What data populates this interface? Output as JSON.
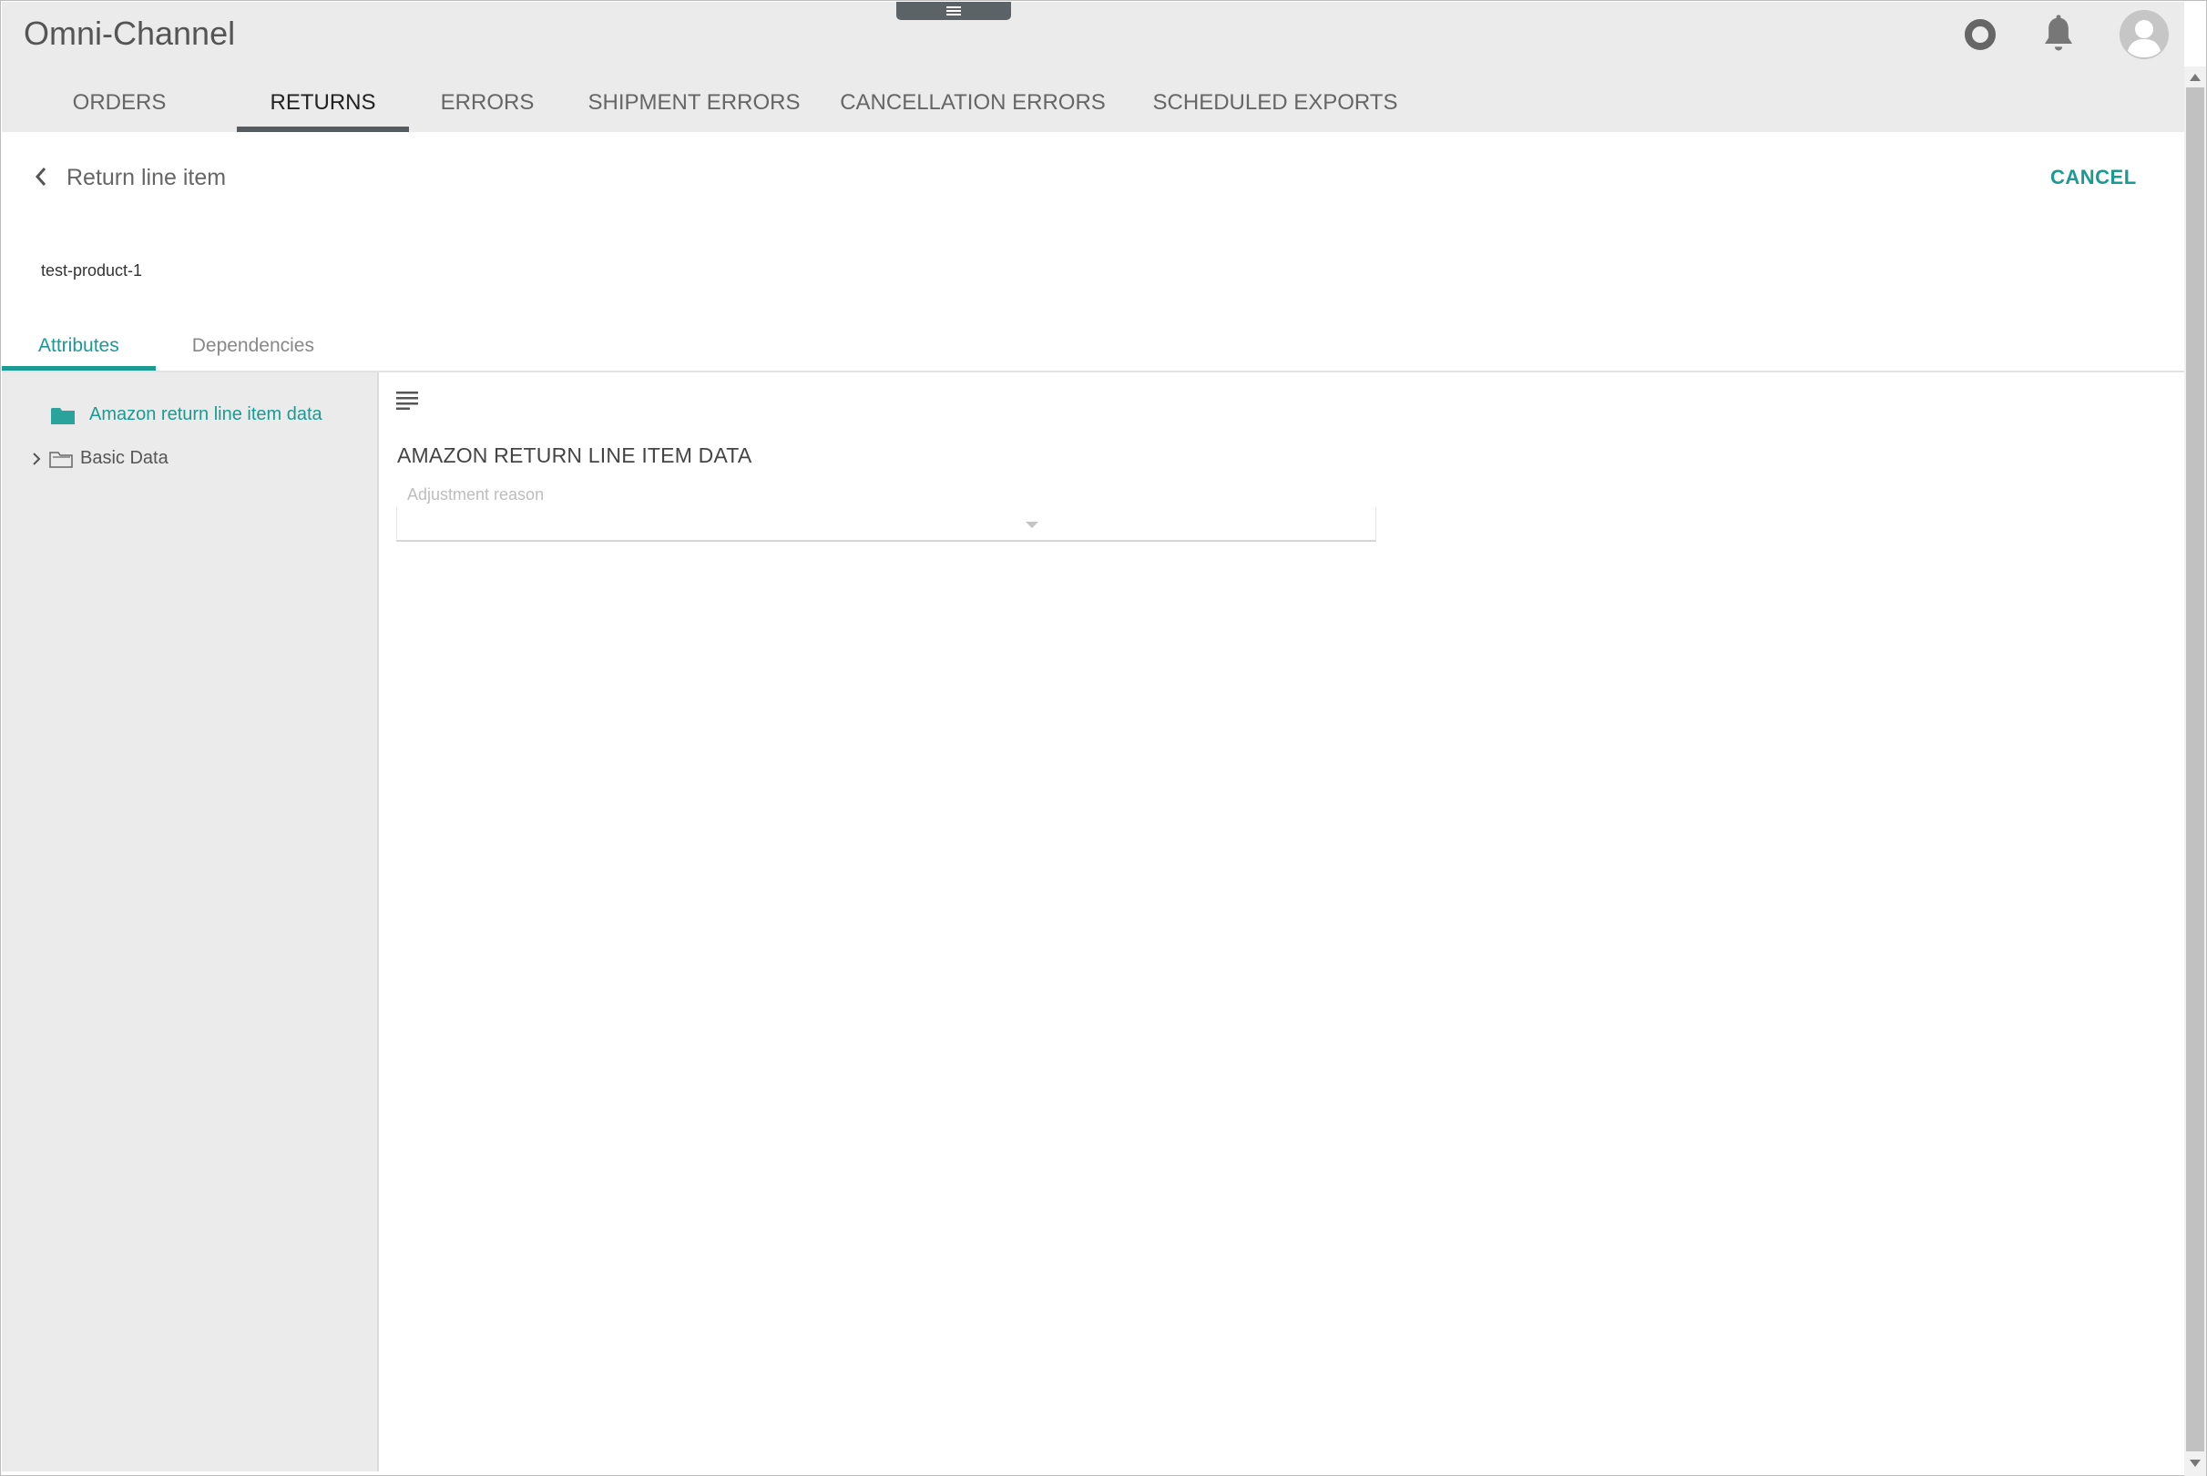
{
  "header": {
    "app_title": "Omni-Channel",
    "icons": [
      "drawer-handle-icon",
      "circle-icon",
      "bell-icon",
      "avatar-icon"
    ]
  },
  "tabs": [
    {
      "label": "ORDERS",
      "active": false
    },
    {
      "label": "RETURNS",
      "active": true
    },
    {
      "label": "ERRORS",
      "active": false
    },
    {
      "label": "SHIPMENT ERRORS",
      "active": false
    },
    {
      "label": "CANCELLATION ERRORS",
      "active": false
    },
    {
      "label": "SCHEDULED EXPORTS",
      "active": false
    }
  ],
  "page": {
    "title": "Return line item",
    "cancel_label": "CANCEL",
    "product_id": "test-product-1"
  },
  "sub_tabs": [
    {
      "label": "Attributes",
      "active": true
    },
    {
      "label": "Dependencies",
      "active": false
    }
  ],
  "tree": {
    "items": [
      {
        "label": "Amazon return line item data",
        "selected": true
      },
      {
        "label": "Basic Data",
        "selected": false
      }
    ]
  },
  "main": {
    "section_title": "AMAZON RETURN LINE ITEM DATA",
    "field": {
      "label": "Adjustment reason",
      "value": ""
    }
  },
  "colors": {
    "accent": "#1a9a93",
    "header_bg": "#ebebeb",
    "tab_indicator": "#555b5e"
  }
}
